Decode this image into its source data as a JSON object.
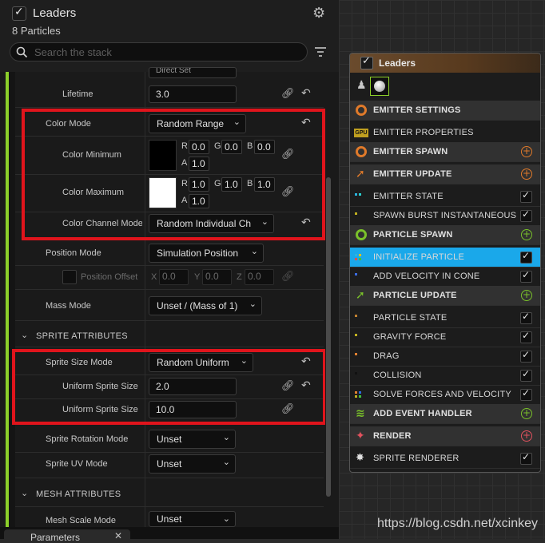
{
  "panel": {
    "title": "Leaders",
    "subtitle": "8 Particles",
    "search_placeholder": "Search the stack"
  },
  "props": {
    "clipped_value": "Direct Set",
    "lifetime_label": "Lifetime",
    "lifetime_value": "3.0",
    "color_mode_label": "Color Mode",
    "color_mode_value": "Random Range",
    "color_min_label": "Color Minimum",
    "color_min": {
      "r": "0.0",
      "g": "0.0",
      "b": "0.0",
      "a": "1.0"
    },
    "color_max_label": "Color Maximum",
    "color_max": {
      "r": "1.0",
      "g": "1.0",
      "b": "1.0",
      "a": "1.0"
    },
    "channel_labels": {
      "r": "R",
      "g": "G",
      "b": "B",
      "a": "A"
    },
    "color_channel_label": "Color Channel Mode",
    "color_channel_value": "Random Individual Ch",
    "position_mode_label": "Position Mode",
    "position_mode_value": "Simulation Position",
    "position_offset_label": "Position Offset",
    "position_offset": {
      "x_label": "X",
      "x": "0.0",
      "y_label": "Y",
      "y": "0.0",
      "z_label": "Z",
      "z": "0.0"
    },
    "mass_mode_label": "Mass Mode",
    "mass_mode_value": "Unset / (Mass of 1)",
    "sprite_section": "SPRITE ATTRIBUTES",
    "sprite_size_mode_label": "Sprite Size Mode",
    "sprite_size_mode_value": "Random Uniform",
    "uniform_size1_label": "Uniform Sprite Size",
    "uniform_size1_value": "2.0",
    "uniform_size2_label": "Uniform Sprite Size",
    "uniform_size2_value": "10.0",
    "sprite_rotation_label": "Sprite Rotation Mode",
    "sprite_rotation_value": "Unset",
    "sprite_uv_label": "Sprite UV Mode",
    "sprite_uv_value": "Unset",
    "mesh_section": "MESH ATTRIBUTES",
    "mesh_scale_label": "Mesh Scale Mode",
    "mesh_scale_value": "Unset"
  },
  "bottom_tab": {
    "label": "Parameters"
  },
  "node": {
    "title": "Leaders",
    "rows": [
      {
        "label": "EMITTER SETTINGS",
        "type": "section"
      },
      {
        "label": "EMITTER PROPERTIES",
        "type": "item"
      },
      {
        "label": "EMITTER SPAWN",
        "type": "section"
      },
      {
        "label": "EMITTER UPDATE",
        "type": "section"
      },
      {
        "label": "EMITTER STATE",
        "type": "item"
      },
      {
        "label": "SPAWN BURST INSTANTANEOUS",
        "type": "item"
      },
      {
        "label": "PARTICLE SPAWN",
        "type": "section"
      },
      {
        "label": "INITIALIZE PARTICLE",
        "type": "item",
        "selected": true
      },
      {
        "label": "ADD VELOCITY IN CONE",
        "type": "item"
      },
      {
        "label": "PARTICLE UPDATE",
        "type": "section"
      },
      {
        "label": "PARTICLE STATE",
        "type": "item"
      },
      {
        "label": "GRAVITY FORCE",
        "type": "item"
      },
      {
        "label": "DRAG",
        "type": "item"
      },
      {
        "label": "COLLISION",
        "type": "item"
      },
      {
        "label": "SOLVE FORCES AND VELOCITY",
        "type": "item"
      },
      {
        "label": "ADD EVENT HANDLER",
        "type": "section"
      },
      {
        "label": "RENDER",
        "type": "section"
      },
      {
        "label": "SPRITE RENDERER",
        "type": "item"
      }
    ]
  },
  "watermark": "https://blog.csdn.net/xcinkey",
  "colors": {
    "accent_green": "#8ccf2a",
    "highlight": "#e0141c",
    "selected_row": "#1aa8ea",
    "node_header": "#6a4b2d"
  }
}
